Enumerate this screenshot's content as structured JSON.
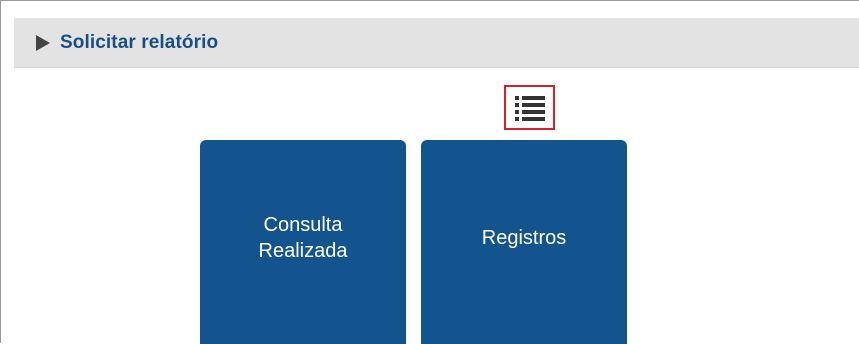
{
  "panel": {
    "title": "Solicitar relatório",
    "toggle_icon": "triangle-right-icon"
  },
  "toolbar": {
    "list_view_icon": "list-icon",
    "highlight_color": "#d2232a"
  },
  "tiles": [
    {
      "label": "Consulta\nRealizada"
    },
    {
      "label": "Registros"
    }
  ],
  "colors": {
    "brand_blue": "#13548f",
    "title_blue": "#1a4f86",
    "header_gray": "#e3e3e3"
  }
}
